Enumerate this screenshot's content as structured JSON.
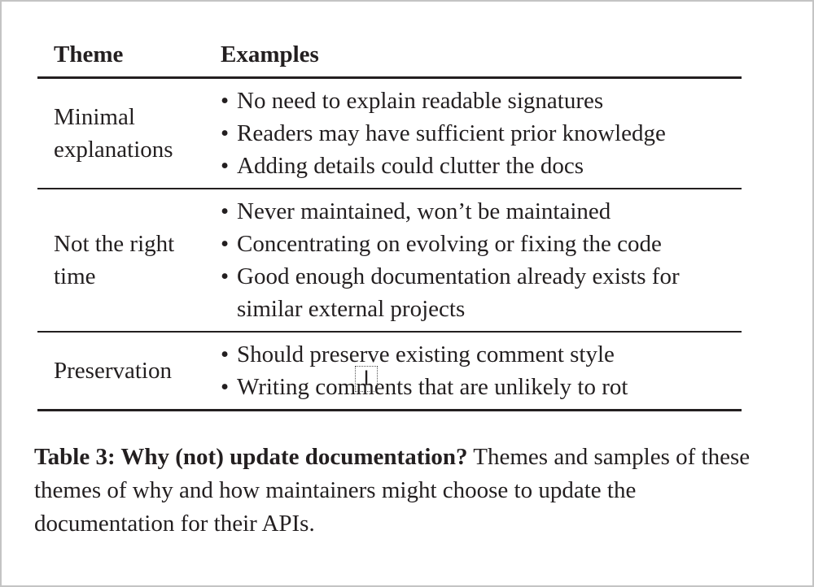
{
  "table": {
    "headers": {
      "theme": "Theme",
      "examples": "Examples"
    },
    "rows": [
      {
        "theme": [
          "Minimal",
          "explanations"
        ],
        "examples": [
          "No need to explain readable signatures",
          "Readers may have sufficient prior knowledge",
          "Adding details could clutter the docs"
        ]
      },
      {
        "theme": [
          "Not the right",
          "time"
        ],
        "examples": [
          "Never maintained, won’t be maintained",
          "Concentrating on evolving or fixing the code",
          "Good enough documentation already exists for similar external projects"
        ]
      },
      {
        "theme": [
          "Preservation"
        ],
        "examples": [
          "Should preserve existing comment style",
          "Writing comments that are unlikely to rot"
        ]
      }
    ],
    "bullet": "•"
  },
  "caption": {
    "label": "Table 3: Why (not) update documentation?",
    "text": " Themes and samples of these themes of why and how maintainers might choose to update the documentation for their APIs."
  },
  "cursor": {
    "icon": "text-cursor-icon",
    "glyph": "I"
  }
}
